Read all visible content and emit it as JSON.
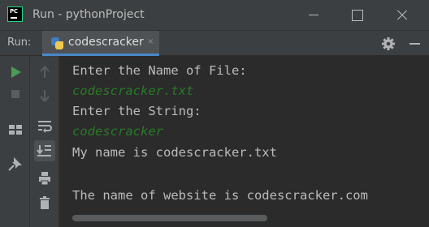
{
  "window": {
    "logo_text": "PC",
    "title": "Run - pythonProject"
  },
  "run_panel": {
    "label": "Run:",
    "tab": {
      "label": "codescracker",
      "close_glyph": "×",
      "icon": "python-file-icon"
    }
  },
  "console": {
    "lines": [
      {
        "text": "Enter the Name of File:",
        "kind": "output"
      },
      {
        "text": "codescracker.txt",
        "kind": "input"
      },
      {
        "text": "Enter the String:",
        "kind": "output"
      },
      {
        "text": "codescracker",
        "kind": "input"
      },
      {
        "text": "My name is codescracker.txt",
        "kind": "output"
      },
      {
        "text": "",
        "kind": "output"
      },
      {
        "text": "The name of website is codescracker.com",
        "kind": "output"
      }
    ]
  },
  "colors": {
    "background": "#2b2b2b",
    "chrome": "#3c3f41",
    "output_text": "#bbbbbb",
    "user_input_text": "#287b28",
    "run_green": "#499c54",
    "tab_underline": "#4a88c7"
  }
}
